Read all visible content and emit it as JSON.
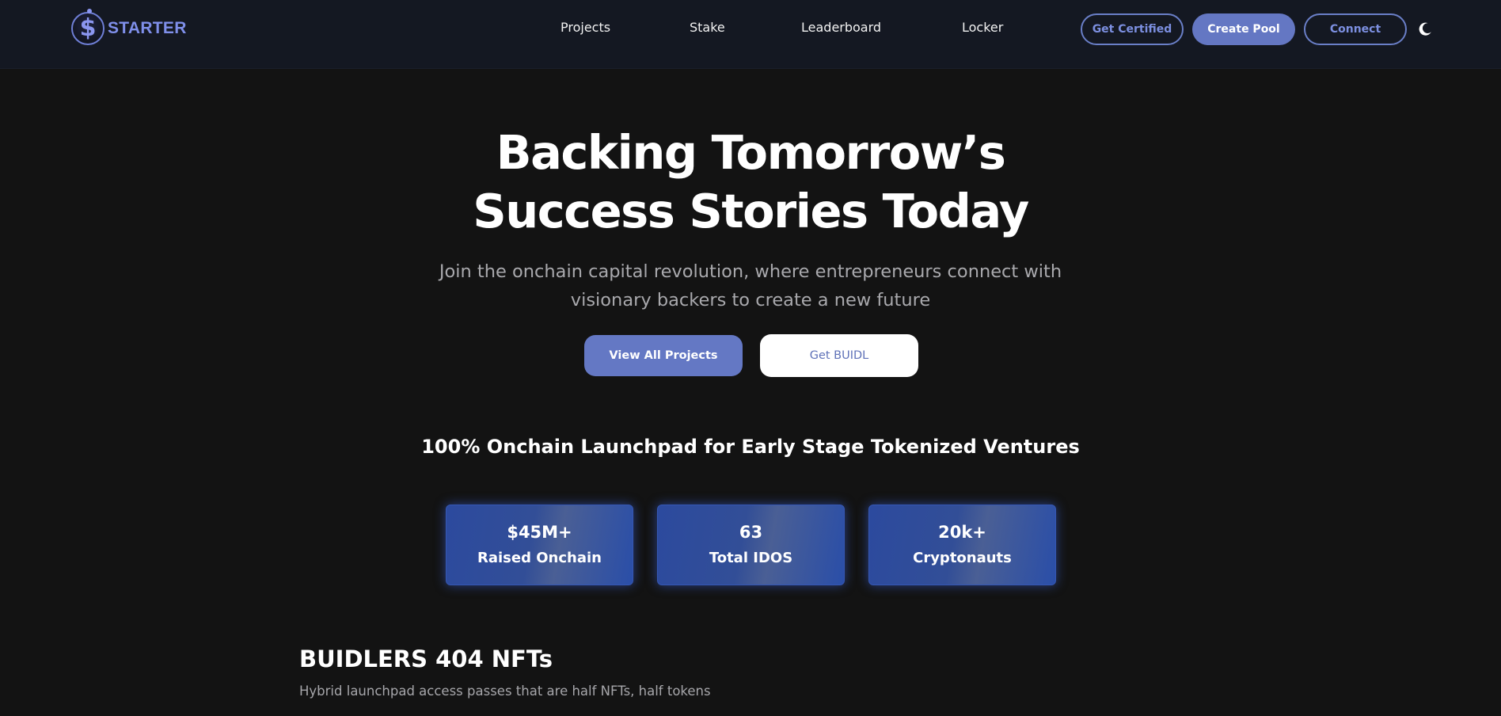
{
  "brand": {
    "name": "STARTER",
    "logo_icon": "starter-dollar-logo"
  },
  "nav": {
    "links": [
      "Projects",
      "Stake",
      "Leaderboard",
      "Locker"
    ],
    "get_certified": "Get Certified",
    "create_pool": "Create Pool",
    "connect": "Connect",
    "theme_icon": "moon-icon"
  },
  "hero": {
    "title_line1": "Backing Tomorrow’s",
    "title_line2": "Success Stories Today",
    "subtitle_line1": "Join the onchain capital revolution, where entrepreneurs connect with",
    "subtitle_line2": "visionary backers to create a new future",
    "primary_cta": "View All Projects",
    "secondary_cta": "Get BUIDL"
  },
  "tagline": "100% Onchain Launchpad for Early Stage Tokenized Ventures",
  "stats": [
    {
      "value": "$45M+",
      "label": "Raised Onchain"
    },
    {
      "value": "63",
      "label": "Total IDOS"
    },
    {
      "value": "20k+",
      "label": "Cryptonauts"
    }
  ],
  "nft_section": {
    "title": "BUIDLERS 404 NFTs",
    "subtitle": "Hybrid launchpad access passes that are half NFTs, half tokens"
  },
  "colors": {
    "background": "#131313",
    "navbar": "#141822",
    "accent": "#6478c4",
    "card_gradient": "#2c4a9e"
  }
}
